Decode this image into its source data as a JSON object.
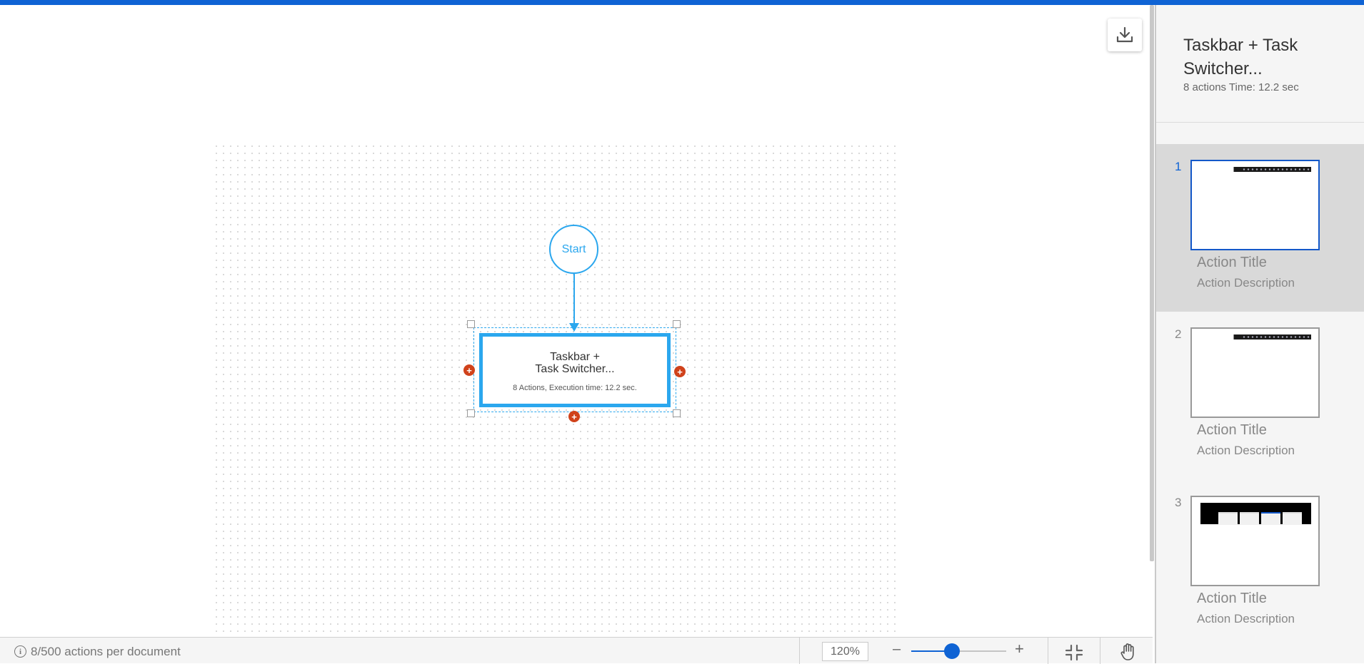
{
  "canvas": {
    "start_label": "Start",
    "node": {
      "title": "Taskbar +\nTask Switcher...",
      "subtitle": "8 Actions, Execution time: 12.2 sec."
    }
  },
  "bottom": {
    "actions_count": "8/500 actions per document",
    "zoom": "120%",
    "zoom_level": 0.43,
    "minus": "–",
    "plus": "+"
  },
  "panel": {
    "title": "Taskbar + Task Switcher...",
    "meta": "8 actions Time: 12.2 sec",
    "steps": [
      {
        "num": "1",
        "title": "Action Title",
        "desc": "Action Description",
        "active": true
      },
      {
        "num": "2",
        "title": "Action Title",
        "desc": "Action Description",
        "active": false
      },
      {
        "num": "3",
        "title": "Action Title",
        "desc": "Action Description",
        "active": false
      }
    ]
  },
  "colors": {
    "accent": "#0f63d4",
    "flow_blue": "#2ba7ee",
    "add_red": "#d0421b"
  },
  "icons": [
    "download-icon",
    "info-icon",
    "fit-screen-icon",
    "hand-icon",
    "add-icon"
  ]
}
